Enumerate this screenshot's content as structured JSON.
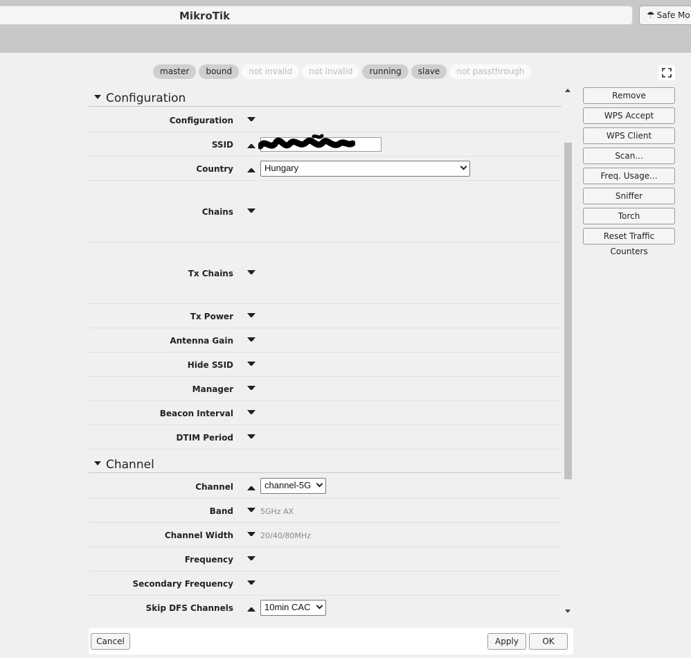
{
  "header": {
    "app_title": "MikroTik",
    "safe_mode_label": "Safe Mo"
  },
  "flags": [
    {
      "label": "master",
      "active": true
    },
    {
      "label": "bound",
      "active": true
    },
    {
      "label": "not invalid",
      "active": false
    },
    {
      "label": "not invalid",
      "active": false
    },
    {
      "label": "running",
      "active": true
    },
    {
      "label": "slave",
      "active": true
    },
    {
      "label": "not passthrough",
      "active": false
    }
  ],
  "sections": {
    "configuration": {
      "title": "Configuration",
      "rows": {
        "configuration": "Configuration",
        "ssid": "SSID",
        "country": "Country",
        "chains": "Chains",
        "tx_chains": "Tx Chains",
        "tx_power": "Tx Power",
        "antenna_gain": "Antenna Gain",
        "hide_ssid": "Hide SSID",
        "manager": "Manager",
        "beacon_interval": "Beacon Interval",
        "dtim_period": "DTIM Period"
      },
      "values": {
        "ssid": "",
        "country": "Hungary"
      }
    },
    "channel": {
      "title": "Channel",
      "rows": {
        "channel": "Channel",
        "band": "Band",
        "channel_width": "Channel Width",
        "frequency": "Frequency",
        "secondary_frequency": "Secondary Frequency",
        "skip_dfs_channels": "Skip DFS Channels"
      },
      "values": {
        "channel": "channel-5G",
        "band": "5GHz AX",
        "channel_width": "20/40/80MHz",
        "skip_dfs_channels": "10min CAC"
      }
    }
  },
  "side_buttons": {
    "remove": "Remove",
    "wps_accept": "WPS Accept",
    "wps_client": "WPS Client",
    "scan": "Scan...",
    "freq_usage": "Freq. Usage...",
    "sniffer": "Sniffer",
    "torch": "Torch",
    "reset_counters": "Reset Traffic Counters"
  },
  "footer": {
    "cancel": "Cancel",
    "apply": "Apply",
    "ok": "OK"
  }
}
